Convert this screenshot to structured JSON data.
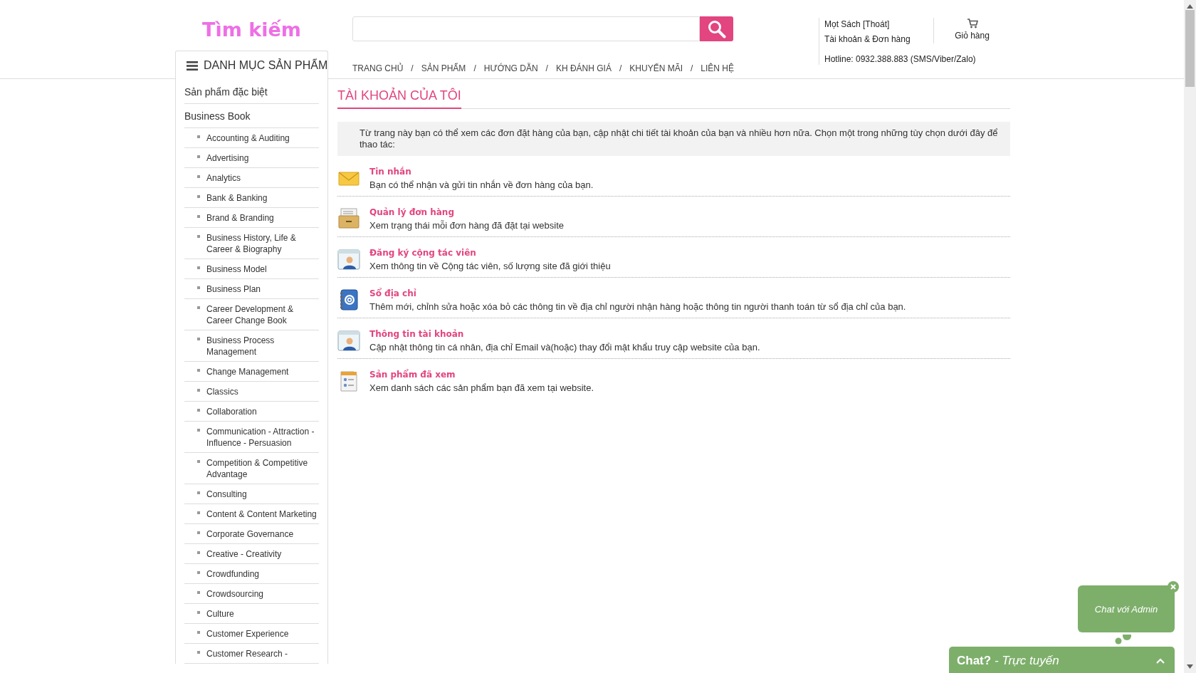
{
  "header": {
    "logo": "Tìm kiếm"
  },
  "account": {
    "user_link": "Mọt Sách [Thoát]",
    "orders_link": "Tài khoản & Đơn hàng",
    "hotline": "Hotline: 0932.388.883 (SMS/Viber/Zalo)"
  },
  "cart": {
    "label": "Giỏ hàng"
  },
  "nav": {
    "links": [
      "TRANG CHỦ",
      "SẢN PHẨM",
      "HƯỚNG DẪN",
      "KH ĐÁNH GIÁ",
      "KHUYẾN MÃI",
      "LIÊN HỆ"
    ],
    "separators": [
      "/",
      "/",
      "/",
      "/",
      "/"
    ]
  },
  "sidebar": {
    "title": "DANH MỤC SẢN PHẨM",
    "items": [
      {
        "label": "Sản phẩm đặc biệt"
      },
      {
        "label": "Business Book",
        "children": [
          {
            "label": "Accounting & Auditing"
          },
          {
            "label": "Advertising"
          },
          {
            "label": "Analytics"
          },
          {
            "label": "Bank & Banking"
          },
          {
            "label": "Brand & Branding"
          },
          {
            "label": "Business History, Life & Career & Biography"
          },
          {
            "label": "Business Model"
          },
          {
            "label": "Business Plan"
          },
          {
            "label": "Career Development & Career Change Book"
          },
          {
            "label": "Business Process Management"
          },
          {
            "label": "Change Management"
          },
          {
            "label": "Classics"
          },
          {
            "label": "Collaboration"
          },
          {
            "label": "Communication - Attraction - Influence - Persuasion"
          },
          {
            "label": "Competition & Competitive Advantage"
          },
          {
            "label": "Consulting"
          },
          {
            "label": "Content & Content Marketing"
          },
          {
            "label": "Corporate Governance"
          },
          {
            "label": "Creative - Creativity"
          },
          {
            "label": "Crowdfunding"
          },
          {
            "label": "Crowdsourcing"
          },
          {
            "label": "Culture"
          },
          {
            "label": "Customer Experience"
          },
          {
            "label": "Customer Research -"
          }
        ]
      }
    ]
  },
  "main": {
    "title": "TÀI KHOẢN CỦA TÔI",
    "intro": "Từ trang này bạn có thể xem các đơn đặt hàng của bạn, cập nhật chi tiết tài khoản của bạn và nhiều hơn nữa. Chọn một trong những tùy chọn dưới đây để thao tác:",
    "options": [
      {
        "kind": "envelope",
        "title": "Tin nhắn",
        "description": "Bạn có thể nhận và gửi tin nhắn về đơn hàng của bạn."
      },
      {
        "kind": "drawer",
        "title": "Quản lý đơn hàng",
        "description": "Xem trạng thái mỗi đơn hàng đã đặt tại website"
      },
      {
        "kind": "person",
        "title": "Đăng ký cộng tác viên",
        "description": "Xem thông tin về Cộng tác viên, số lượng site đã giới thiệu"
      },
      {
        "kind": "addressbook",
        "title": "Sổ địa chỉ",
        "description": "Thêm mới, chỉnh sửa hoặc xóa bỏ các thông tin về địa chỉ người nhận hàng hoặc thông tin người thanh toán từ sổ địa chỉ của bạn."
      },
      {
        "kind": "person",
        "title": "Thông tin tài khoản",
        "description": "Cập nhật thông tin cá nhân, địa chỉ Email và(hoặc) thay đổi mật khẩu truy cập website của bạn."
      },
      {
        "kind": "document",
        "title": "Sản phẩm đã xem",
        "description": "Xem danh sách các sản phẩm bạn đã xem tại website."
      }
    ]
  },
  "chat": {
    "bubble": "Chat với Admin",
    "bar": "**Chat?** *- Trực tuyến*"
  }
}
